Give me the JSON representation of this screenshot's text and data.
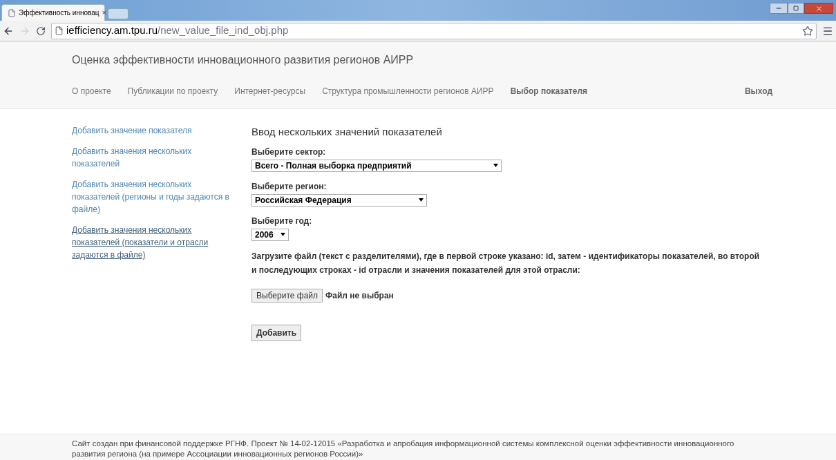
{
  "browser": {
    "tab_title": "Эффективность инновац",
    "tab_close": "×",
    "url_host": "iefficiency.am.tpu.ru",
    "url_path": "/new_value_file_ind_obj.php"
  },
  "site_title": "Оценка эффективности инновационного развития регионов АИРР",
  "nav": [
    {
      "label": "О проекте",
      "selected": false
    },
    {
      "label": "Публикации по проекту",
      "selected": false
    },
    {
      "label": "Интернет-ресурсы",
      "selected": false
    },
    {
      "label": "Структура промышленности регионов АИРР",
      "selected": false
    },
    {
      "label": "Выбор показателя",
      "selected": true
    }
  ],
  "logout": "Выход",
  "sidebar": [
    {
      "label": "Добавить значение показателя",
      "selected": false
    },
    {
      "label": "Добавить значения нескольких показателей",
      "selected": false
    },
    {
      "label": "Добавить значения нескольких показателей (регионы и годы задаются в файле)",
      "selected": false
    },
    {
      "label": "Добавить значения нескольких показателей (показатели и отрасли задаются в файле)",
      "selected": true
    }
  ],
  "form": {
    "heading": "Ввод нескольких значений показателей",
    "selects": [
      {
        "label": "Выберите сектор:",
        "value": "Всего - Полная выборка предприятий"
      },
      {
        "label": "Выберите регион:",
        "value": "Российская Федерация"
      },
      {
        "label": "Выберите год:",
        "value": "2006"
      }
    ],
    "instructions": "Загрузите файл (текст с разделителями), где в первой строке указано: id, затем - идентификаторы показателей, во второй и последующих строках - id отрасли и значения показателей для этой отрасли:",
    "file_button": "Выберите файл",
    "file_status": "Файл не выбран",
    "submit": "Добавить"
  },
  "footer": "Сайт создан при финансовой поддержке РГНФ. Проект № 14-02-12015 «Разработка и апробация информационной системы комплексной оценки эффективности инновационного развития региона (на примере Ассоциации инновационных регионов России)»"
}
